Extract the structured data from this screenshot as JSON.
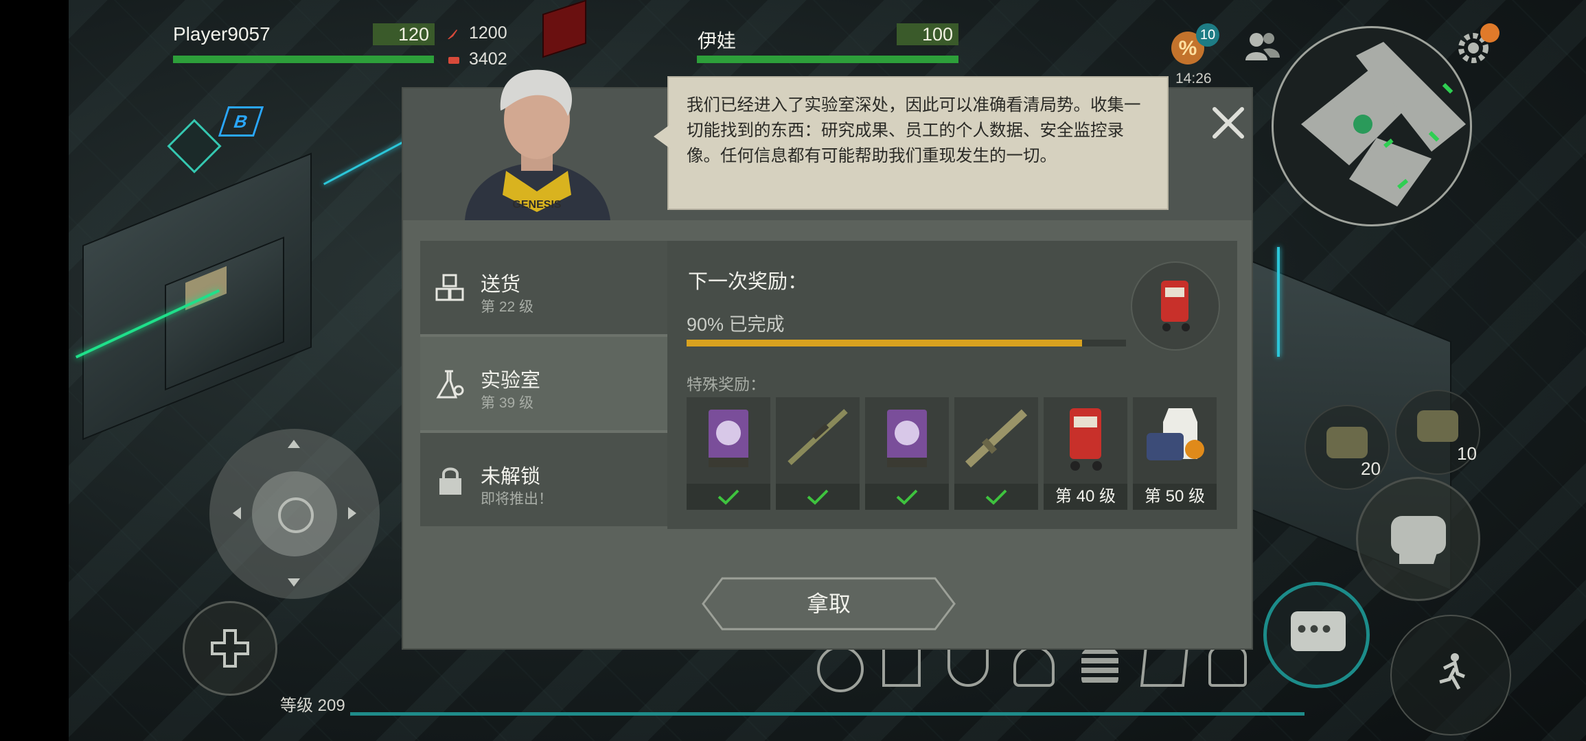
{
  "player": {
    "name": "Player9057",
    "hp": "120",
    "hp_fraction": 1.0
  },
  "resources": {
    "first": "1200",
    "second": "3402"
  },
  "companion": {
    "name": "伊娃",
    "hp": "100",
    "hp_fraction": 1.0
  },
  "top_right": {
    "discount_badge": "10",
    "time": "14:26"
  },
  "dialog": {
    "speech": "我们已经进入了实验室深处，因此可以准确看清局势。收集一切能找到的东西：研究成果、员工的个人数据、安全监控录像。任何信息都有可能帮助我们重现发生的一切。",
    "menu": [
      {
        "title": "送货",
        "subtitle": "第 22 级"
      },
      {
        "title": "实验室",
        "subtitle": "第 39 级"
      },
      {
        "title": "未解锁",
        "subtitle": "即将推出！"
      }
    ],
    "next_reward_label": "下一次奖励：",
    "progress_text": "90% 已完成",
    "progress_fraction": 0.9,
    "special_rewards_label": "特殊奖励：",
    "rewards": [
      {
        "icon": "purple-recipe-card-icon",
        "status": "claimed"
      },
      {
        "icon": "sniper-rifle-icon",
        "status": "claimed"
      },
      {
        "icon": "purple-recipe-card-icon",
        "status": "claimed"
      },
      {
        "icon": "assault-rifle-icon",
        "status": "claimed"
      },
      {
        "icon": "red-cart-icon",
        "label": "第 40 级"
      },
      {
        "icon": "vest-box-icon",
        "label": "第 50 级"
      }
    ],
    "take_button": "拿取"
  },
  "hud": {
    "level_text": "等级 209",
    "bag_count_1": "20",
    "bag_count_2": "10"
  },
  "colors": {
    "accent_yellow": "#d9a21f",
    "hp_green": "#2d9f3a",
    "panel": "#5c625c"
  }
}
